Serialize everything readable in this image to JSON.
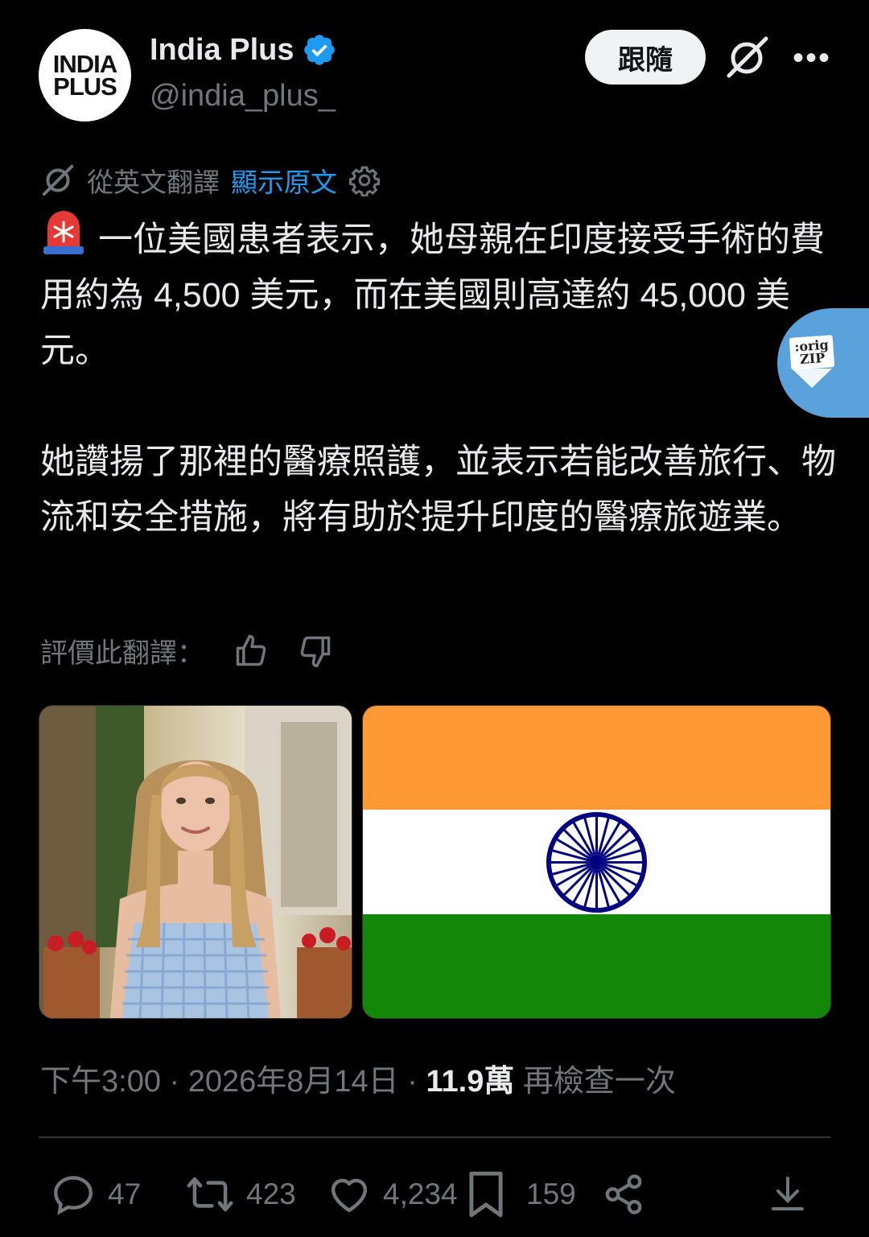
{
  "header": {
    "avatar_line1": "INDIA",
    "avatar_line2": "PLUS",
    "display_name": "India Plus",
    "handle": "@india_plus_",
    "follow_label": "跟隨",
    "more_label": "•••"
  },
  "translation": {
    "label": "從英文翻譯",
    "show_original": "顯示原文"
  },
  "tweet": {
    "paragraph1": "一位美國患者表示，她母親在印度接受手術的費用約為 4,500 美元，而在美國則高達約 45,000 美元。",
    "paragraph2": "她讚揚了那裡的醫療照護，並表示若能改善旅行、物流和安全措施，將有助於提升印度的醫療旅遊業。"
  },
  "rate_translation": "評價此翻譯：",
  "zip_badge": {
    "line1": ":orig",
    "line2": "ZIP"
  },
  "meta": {
    "time": "下午3:00",
    "date": "2026年8月14日",
    "views": "11.9萬",
    "recheck": "再檢查一次"
  },
  "actions": {
    "replies": "47",
    "reposts": "423",
    "likes": "4,234",
    "bookmarks": "159"
  },
  "colors": {
    "background": "#000000",
    "link": "#1d9bf0",
    "muted": "#71767b",
    "verified": "#1d9bf0",
    "flag_saffron": "#ff9933",
    "flag_green": "#138808",
    "chakra_blue": "#000080"
  }
}
